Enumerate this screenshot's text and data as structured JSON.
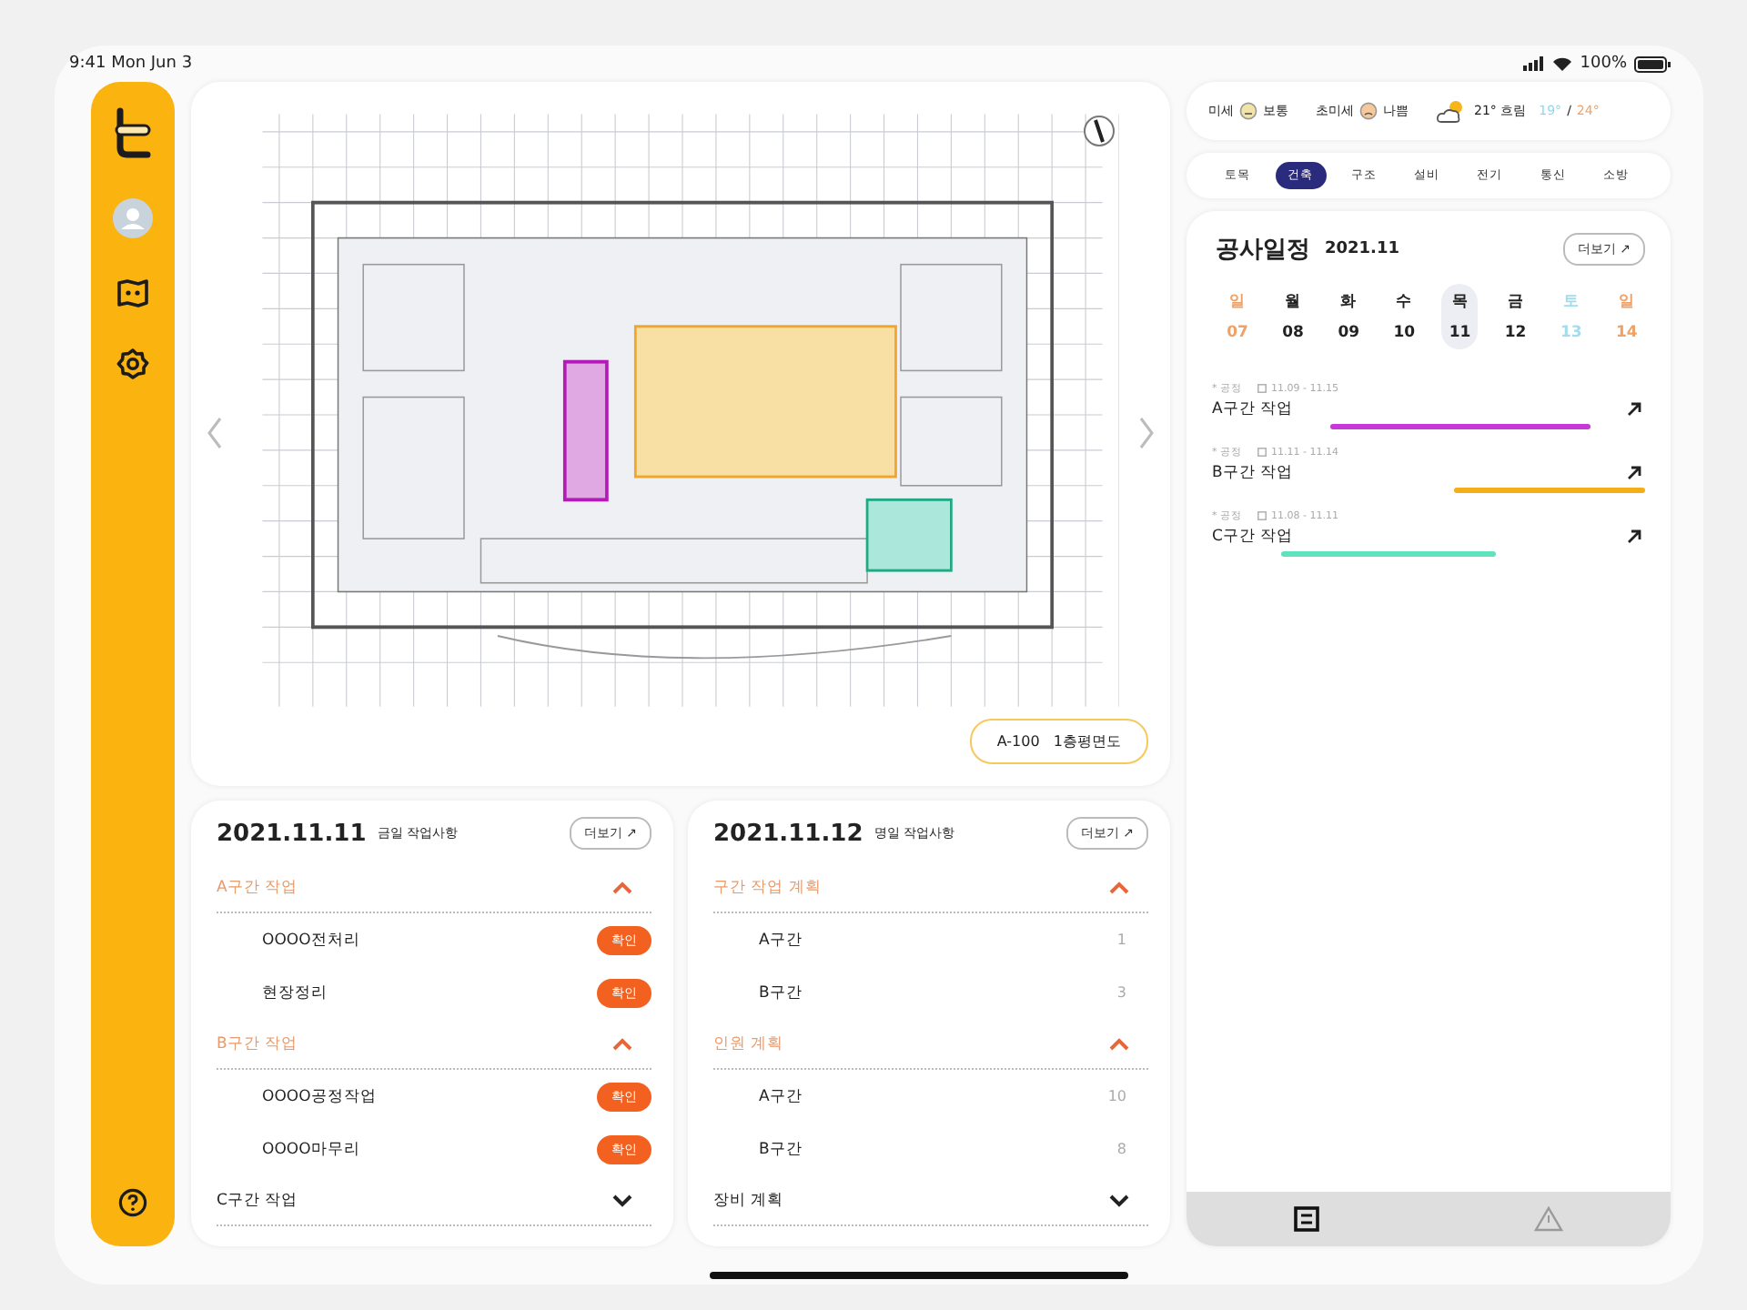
{
  "status_bar": {
    "time": "9:41 Mon Jun 3",
    "battery": "100%"
  },
  "map": {
    "sheet_code": "A-100",
    "sheet_name": "1층평면도"
  },
  "today": {
    "date": "2021.11.11",
    "subtitle": "금일 작업사항",
    "more": "더보기 ↗",
    "groups": [
      {
        "title": "A구간 작업",
        "expanded": true,
        "items": [
          {
            "name": "OOOO전처리",
            "action": "확인"
          },
          {
            "name": "현장정리",
            "action": "확인"
          }
        ]
      },
      {
        "title": "B구간 작업",
        "expanded": true,
        "items": [
          {
            "name": "OOOO공정작업",
            "action": "확인"
          },
          {
            "name": "OOOO마무리",
            "action": "확인"
          }
        ]
      },
      {
        "title": "C구간 작업",
        "expanded": false
      }
    ]
  },
  "tomorrow": {
    "date": "2021.11.12",
    "subtitle": "명일 작업사항",
    "more": "더보기 ↗",
    "groups": [
      {
        "title": "구간 작업 계획",
        "expanded": true,
        "items": [
          {
            "name": "A구간",
            "value": "1"
          },
          {
            "name": "B구간",
            "value": "3"
          }
        ]
      },
      {
        "title": "인원 계획",
        "expanded": true,
        "items": [
          {
            "name": "A구간",
            "value": "10"
          },
          {
            "name": "B구간",
            "value": "8"
          }
        ]
      },
      {
        "title": "장비 계획",
        "expanded": false
      }
    ]
  },
  "weather": {
    "fine_dust_label": "미세",
    "fine_dust": "보통",
    "ultra_fine_dust_label": "초미세",
    "ultra_fine_dust": "나쁨",
    "condition": "21° 흐림",
    "low": "19°",
    "separator": "/",
    "high": "24°"
  },
  "trade_tabs": [
    {
      "label": "토목",
      "selected": false
    },
    {
      "label": "건축",
      "selected": true
    },
    {
      "label": "구조",
      "selected": false
    },
    {
      "label": "설비",
      "selected": false
    },
    {
      "label": "전기",
      "selected": false
    },
    {
      "label": "통신",
      "selected": false
    },
    {
      "label": "소방",
      "selected": false
    }
  ],
  "schedule": {
    "title": "공사일정",
    "month": "2021.11",
    "more": "더보기 ↗",
    "days": [
      {
        "weekday": "일",
        "date": "07",
        "kind": "sunday",
        "selected": false
      },
      {
        "weekday": "월",
        "date": "08",
        "kind": "weekday",
        "selected": false
      },
      {
        "weekday": "화",
        "date": "09",
        "kind": "weekday",
        "selected": false
      },
      {
        "weekday": "수",
        "date": "10",
        "kind": "weekday",
        "selected": false
      },
      {
        "weekday": "목",
        "date": "11",
        "kind": "weekday",
        "selected": true
      },
      {
        "weekday": "금",
        "date": "12",
        "kind": "weekday",
        "selected": false
      },
      {
        "weekday": "토",
        "date": "13",
        "kind": "saturday",
        "selected": false
      },
      {
        "weekday": "일",
        "date": "14",
        "kind": "sunday",
        "selected": false
      }
    ],
    "tasks": [
      {
        "tag": "* 공정",
        "period": "11.09 - 11.15",
        "name": "A구간 작업",
        "color": "#c639d6"
      },
      {
        "tag": "* 공정",
        "period": "11.11 - 11.14",
        "name": "B구간 작업",
        "color": "#f5ad18"
      },
      {
        "tag": "* 공정",
        "period": "11.08 - 11.11",
        "name": "C구간 작업",
        "color": "#5ee3be"
      }
    ]
  },
  "bottom_tabs": [
    {
      "kind": "document",
      "selected": true
    },
    {
      "kind": "warning",
      "selected": false
    }
  ]
}
